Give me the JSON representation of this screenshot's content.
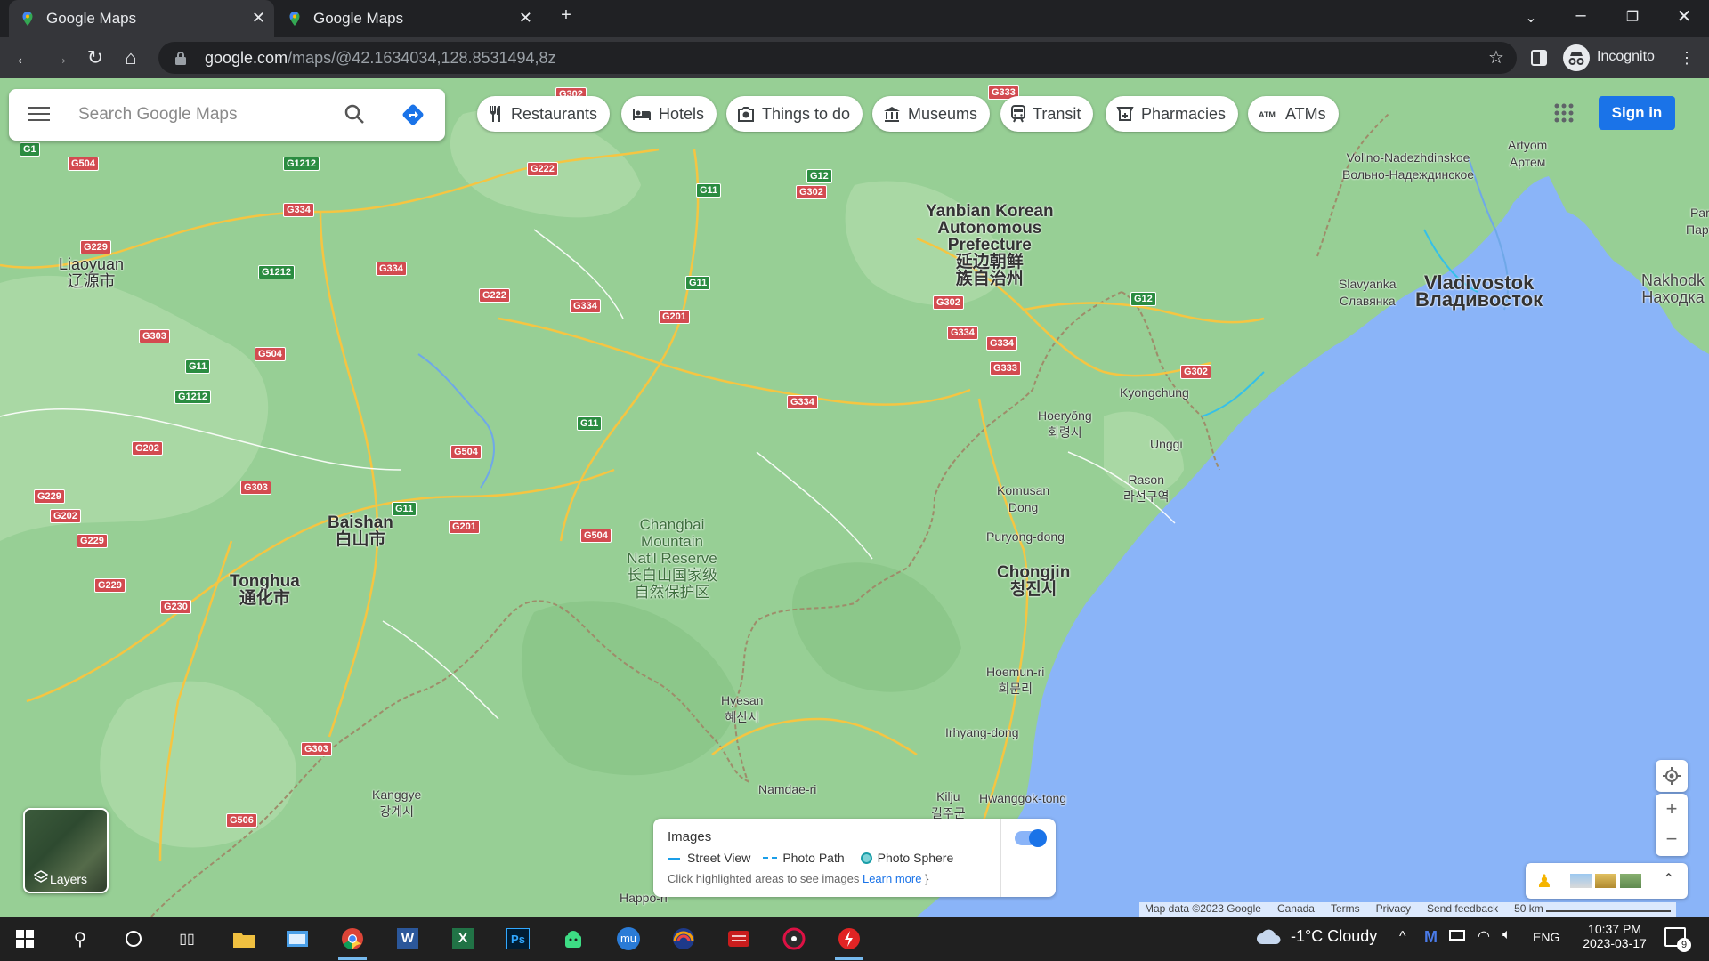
{
  "browser": {
    "tabs": [
      {
        "title": "Google Maps",
        "active": true
      },
      {
        "title": "Google Maps",
        "active": false
      }
    ],
    "address": {
      "host": "google.com",
      "path": "/maps/@42.1634034,128.8531494,8z"
    },
    "profile_label": "Incognito"
  },
  "search": {
    "placeholder": "Search Google Maps"
  },
  "chips": [
    {
      "label": "Restaurants",
      "icon": "fork-knife-icon"
    },
    {
      "label": "Hotels",
      "icon": "bed-icon"
    },
    {
      "label": "Things to do",
      "icon": "camera-icon"
    },
    {
      "label": "Museums",
      "icon": "museum-icon"
    },
    {
      "label": "Transit",
      "icon": "train-icon"
    },
    {
      "label": "Pharmacies",
      "icon": "pharmacy-icon"
    },
    {
      "label": "ATMs",
      "icon": "atm-icon"
    }
  ],
  "signin_label": "Sign in",
  "map_labels": {
    "liaoyuan": "Liaoyuan",
    "liaoyuan_cn": "辽源市",
    "baishan": "Baishan",
    "baishan_cn": "白山市",
    "tonghua": "Tonghua",
    "tonghua_cn": "通化市",
    "yanbian1": "Yanbian Korean",
    "yanbian2": "Autonomous",
    "yanbian3": "Prefecture",
    "yanbian_cn1": "延边朝鲜",
    "yanbian_cn2": "族自治州",
    "changbai1": "Changbai",
    "changbai2": "Mountain",
    "changbai3": "Nat'l Reserve",
    "changbai_cn1": "长白山国家级",
    "changbai_cn2": "自然保护区",
    "vladivostok": "Vladivostok",
    "vladivostok_ru": "Владивосток",
    "volno1": "Vol'no-Nadezhdinskoe",
    "volno2": "Вольно-Надеждинское",
    "artyom": "Artyom",
    "artyom_ru": "Артем",
    "slavyanka": "Slavyanka",
    "slavyanka_ru": "Славянка",
    "nakhodka": "Nakhodk",
    "nakhodka_ru": "Находка",
    "par": "Par",
    "par_ru": "Парт",
    "kyongchung": "Kyongchung",
    "hoeryong": "Hoeryŏng",
    "hoeryong_kr": "회령시",
    "unggi": "Unggi",
    "rason": "Rason",
    "rason_kr": "라선구역",
    "komusan1": "Komusan",
    "komusan2": "Dong",
    "puryong": "Puryong-dong",
    "chongjin": "Chongjin",
    "chongjin_kr": "청진시",
    "hoemun": "Hoemun-ri",
    "hoemun_kr": "회문리",
    "irhyang": "Irhyang-dong",
    "hyesan": "Hyesan",
    "hyesan_kr": "혜산시",
    "namdae": "Namdae-ri",
    "kilju": "Kilju",
    "kilju_kr": "길주군",
    "hwanggok": "Hwanggok-tong",
    "kanggye": "Kanggye",
    "kanggye_kr": "강계시",
    "happo": "Happo-ri"
  },
  "layers_label": "Layers",
  "images_panel": {
    "title": "Images",
    "street_view": "Street View",
    "photo_path": "Photo Path",
    "photo_sphere": "Photo Sphere",
    "hint": "Click highlighted areas to see images",
    "learn_more": "Learn more",
    "toggle_on": true
  },
  "footer": {
    "map_data": "Map data ©2023 Google",
    "country": "Canada",
    "terms": "Terms",
    "privacy": "Privacy",
    "feedback": "Send feedback",
    "scale": "50 km"
  },
  "taskbar": {
    "weather": "-1°C  Cloudy",
    "lang": "ENG",
    "time": "10:37 PM",
    "date": "2023-03-17",
    "notifications": "9"
  },
  "colors": {
    "land": "#97cf95",
    "water": "#8ab4f8",
    "accent": "#1a73e8",
    "road_shield": "#d34b50"
  }
}
